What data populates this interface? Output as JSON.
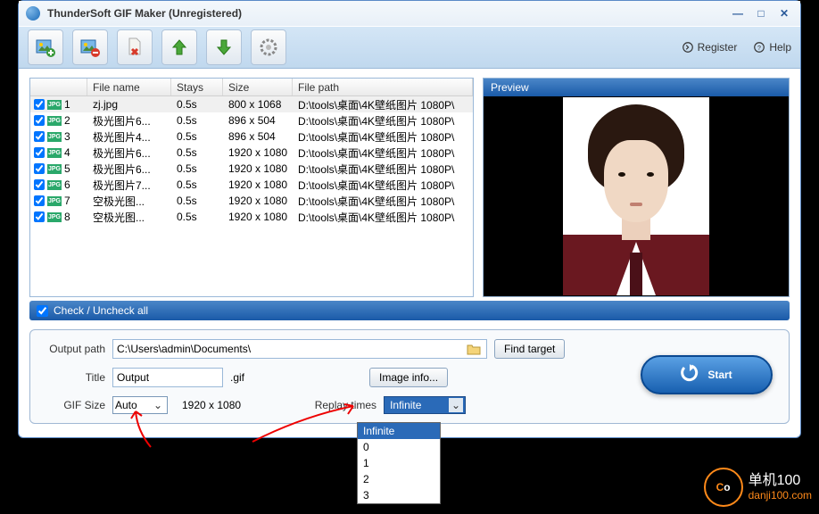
{
  "window": {
    "title": "ThunderSoft GIF Maker (Unregistered)"
  },
  "toolbar_links": {
    "register": "Register",
    "help": "Help"
  },
  "table": {
    "headers": {
      "filename": "File name",
      "stays": "Stays",
      "size": "Size",
      "filepath": "File path"
    },
    "rows": [
      {
        "idx": "1",
        "name": "zj.jpg",
        "stays": "0.5s",
        "size": "800 x 1068",
        "path": "D:\\tools\\桌面\\4K壁纸图片 1080P\\"
      },
      {
        "idx": "2",
        "name": "极光图片6...",
        "stays": "0.5s",
        "size": "896 x 504",
        "path": "D:\\tools\\桌面\\4K壁纸图片 1080P\\"
      },
      {
        "idx": "3",
        "name": "极光图片4...",
        "stays": "0.5s",
        "size": "896 x 504",
        "path": "D:\\tools\\桌面\\4K壁纸图片 1080P\\"
      },
      {
        "idx": "4",
        "name": "极光图片6...",
        "stays": "0.5s",
        "size": "1920 x 1080",
        "path": "D:\\tools\\桌面\\4K壁纸图片 1080P\\"
      },
      {
        "idx": "5",
        "name": "极光图片6...",
        "stays": "0.5s",
        "size": "1920 x 1080",
        "path": "D:\\tools\\桌面\\4K壁纸图片 1080P\\"
      },
      {
        "idx": "6",
        "name": "极光图片7...",
        "stays": "0.5s",
        "size": "1920 x 1080",
        "path": "D:\\tools\\桌面\\4K壁纸图片 1080P\\"
      },
      {
        "idx": "7",
        "name": "空极光图...",
        "stays": "0.5s",
        "size": "1920 x 1080",
        "path": "D:\\tools\\桌面\\4K壁纸图片 1080P\\"
      },
      {
        "idx": "8",
        "name": "空极光图...",
        "stays": "0.5s",
        "size": "1920 x 1080",
        "path": "D:\\tools\\桌面\\4K壁纸图片 1080P\\"
      }
    ]
  },
  "preview": {
    "label": "Preview"
  },
  "check_all": "Check / Uncheck all",
  "options": {
    "output_path_label": "Output path",
    "output_path": "C:\\Users\\admin\\Documents\\",
    "find_target": "Find target",
    "title_label": "Title",
    "title_value": "Output",
    "title_ext": ".gif",
    "image_info": "Image info...",
    "gif_size_label": "GIF Size",
    "gif_size_value": "Auto",
    "gif_size_dims": "1920 x 1080",
    "replay_label": "Replay times",
    "replay_value": "Infinite",
    "start": "Start"
  },
  "dropdown": {
    "items": [
      "Infinite",
      "0",
      "1",
      "2",
      "3"
    ],
    "selected": "Infinite"
  },
  "watermark": {
    "cn": "单机100",
    "url": "danji100.com"
  }
}
